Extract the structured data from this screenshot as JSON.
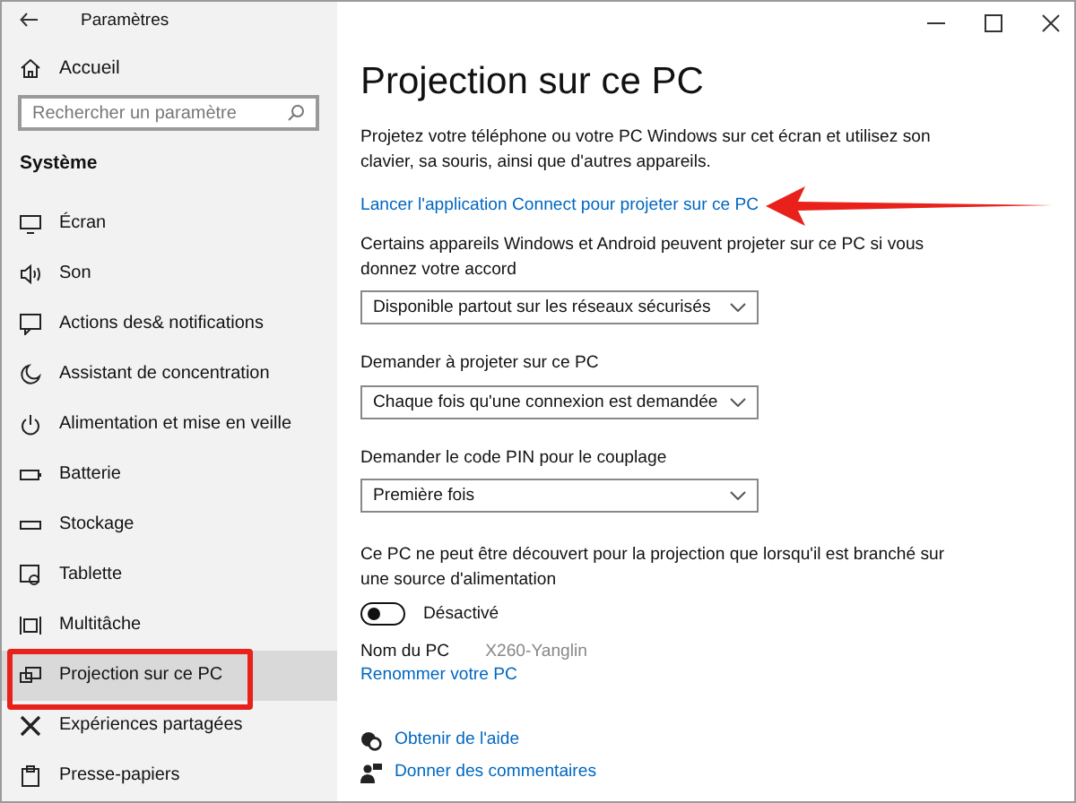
{
  "window": {
    "title": "Paramètres"
  },
  "sidebar": {
    "home": "Accueil",
    "search": {
      "placeholder": "Rechercher un paramètre"
    },
    "section": "Système",
    "items": [
      {
        "label": "Écran",
        "selected": false,
        "highlighted": false
      },
      {
        "label": "Son",
        "selected": false,
        "highlighted": false
      },
      {
        "label": "Actions des& notifications",
        "selected": false,
        "highlighted": false
      },
      {
        "label": "Assistant de concentration",
        "selected": false,
        "highlighted": false
      },
      {
        "label": "Alimentation et mise en veille",
        "selected": false,
        "highlighted": false
      },
      {
        "label": "Batterie",
        "selected": false,
        "highlighted": false
      },
      {
        "label": "Stockage",
        "selected": false,
        "highlighted": false
      },
      {
        "label": "Tablette",
        "selected": false,
        "highlighted": false
      },
      {
        "label": "Multitâche",
        "selected": false,
        "highlighted": false
      },
      {
        "label": "Projection sur ce PC",
        "selected": true,
        "highlighted": true
      },
      {
        "label": "Expériences partagées",
        "selected": false,
        "highlighted": false
      },
      {
        "label": "Presse-papiers",
        "selected": false,
        "highlighted": false
      }
    ]
  },
  "page": {
    "title": "Projection sur ce PC",
    "description": "Projetez votre téléphone ou votre PC Windows sur cet écran et utilisez son clavier, sa souris, ainsi que d'autres appareils.",
    "connect_link": "Lancer l'application Connect pour projeter sur ce PC",
    "dropdowns": [
      {
        "label": "Certains appareils Windows et Android peuvent projeter sur ce PC si vous donnez votre accord",
        "value": "Disponible partout sur les réseaux sécurisés"
      },
      {
        "label": "Demander à projeter sur ce PC",
        "value": "Chaque fois qu'une connexion est demandée"
      },
      {
        "label": "Demander le code PIN pour le couplage",
        "value": "Première fois"
      }
    ],
    "power_note": "Ce PC ne peut être découvert pour la projection que lorsqu'il est branché sur une source d'alimentation",
    "toggle": {
      "on": false,
      "label": "Désactivé"
    },
    "pc_name": {
      "label": "Nom du PC",
      "value": "X260-Yanglin"
    },
    "rename_link": "Renommer votre PC",
    "help_links": [
      "Obtenir de l'aide",
      "Donner des commentaires"
    ]
  }
}
